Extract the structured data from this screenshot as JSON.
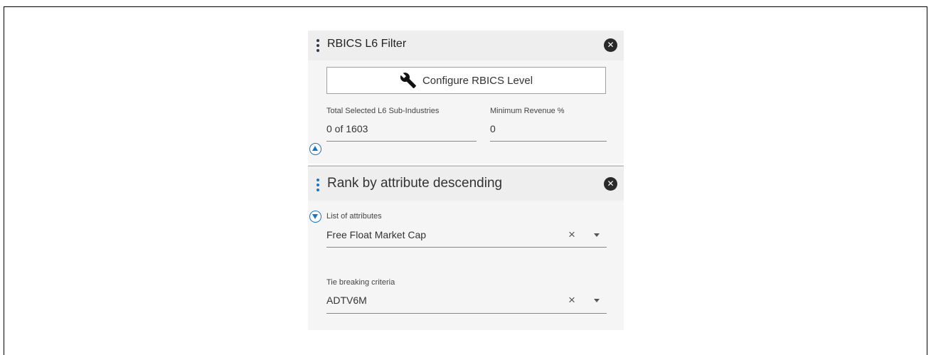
{
  "rbics_panel": {
    "title": "RBICS L6 Filter",
    "close_icon": "close-circle-icon",
    "configure_button_label": "Configure RBICS Level",
    "configure_icon": "wrench-icon",
    "total_selected_label": "Total Selected L6 Sub-Industries",
    "total_selected_value": "0 of 1603",
    "min_revenue_label": "Minimum Revenue %",
    "min_revenue_value": "0",
    "collapse_icon": "chevron-up-circle-icon"
  },
  "rank_panel": {
    "title": "Rank by attribute descending",
    "close_icon": "close-circle-icon",
    "expand_icon": "chevron-down-circle-icon",
    "attributes_label": "List of attributes",
    "attributes_value": "Free Float Market Cap",
    "tie_breaking_label": "Tie breaking criteria",
    "tie_breaking_value": "ADTV6M",
    "clear_glyph": "×"
  },
  "colors": {
    "accent": "#1a73c9",
    "panel_bg": "#f5f5f5",
    "header_bg": "#eeeeee"
  }
}
